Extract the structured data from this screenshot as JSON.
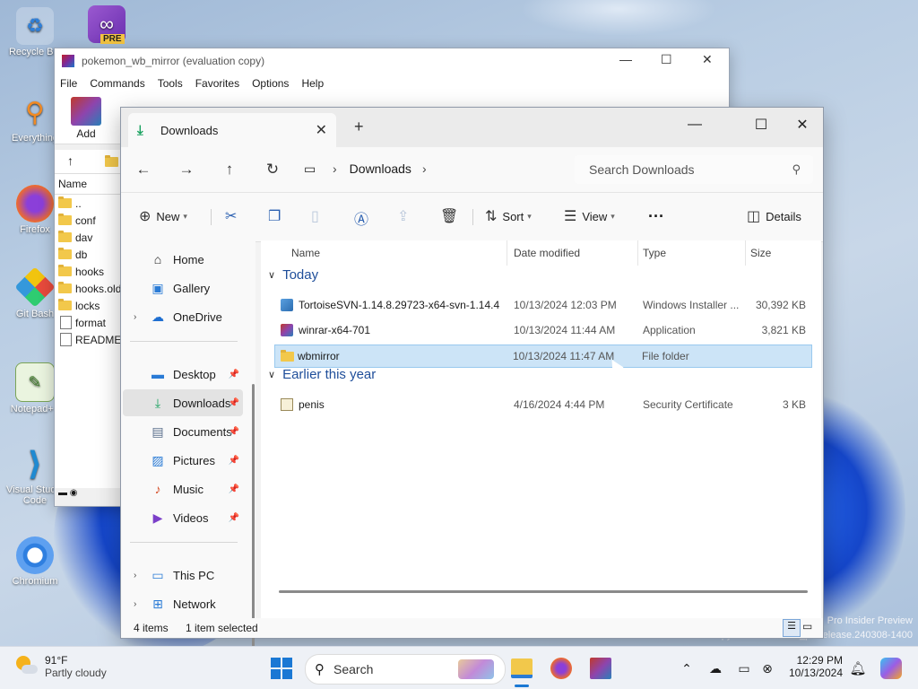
{
  "desktop": {
    "icons": [
      {
        "label": "Recycle Bin",
        "icon": "recycle-bin-icon"
      },
      {
        "label": "Everything",
        "icon": "search-magnifier-icon"
      },
      {
        "label": "Firefox",
        "icon": "firefox-icon"
      },
      {
        "label": "Git Bash",
        "icon": "git-icon"
      },
      {
        "label": "Notepad++",
        "icon": "notepad-plus-icon"
      },
      {
        "label": "Visual Studio Code",
        "icon": "vscode-icon"
      },
      {
        "label": "Chromium",
        "icon": "chromium-icon"
      }
    ],
    "pre_badge": "PRE",
    "watermark_line1": "Pro Insider Preview",
    "watermark_line2": "Evaluation copy. Build 26000.rs_prerelease.240308-1400"
  },
  "winrar": {
    "title": "pokemon_wb_mirror (evaluation copy)",
    "menu": [
      "File",
      "Commands",
      "Tools",
      "Favorites",
      "Options",
      "Help"
    ],
    "add_label": "Add",
    "list_header": "Name",
    "items": [
      {
        "name": "..",
        "type": "folder"
      },
      {
        "name": "conf",
        "type": "folder"
      },
      {
        "name": "dav",
        "type": "folder"
      },
      {
        "name": "db",
        "type": "folder"
      },
      {
        "name": "hooks",
        "type": "folder"
      },
      {
        "name": "hooks.old",
        "type": "folder"
      },
      {
        "name": "locks",
        "type": "folder"
      },
      {
        "name": "format",
        "type": "file"
      },
      {
        "name": "README.txt",
        "type": "file"
      }
    ]
  },
  "explorer": {
    "tab_title": "Downloads",
    "address_crumb": "Downloads",
    "search_placeholder": "Search Downloads",
    "commands": {
      "new": "New",
      "sort": "Sort",
      "view": "View",
      "details": "Details"
    },
    "nav": {
      "home": "Home",
      "gallery": "Gallery",
      "onedrive": "OneDrive",
      "desktop": "Desktop",
      "downloads": "Downloads",
      "documents": "Documents",
      "pictures": "Pictures",
      "music": "Music",
      "videos": "Videos",
      "thispc": "This PC",
      "network": "Network"
    },
    "columns": {
      "name": "Name",
      "date": "Date modified",
      "type": "Type",
      "size": "Size"
    },
    "groups": [
      {
        "label": "Today",
        "files": [
          {
            "name": "TortoiseSVN-1.14.8.29723-x64-svn-1.14.4",
            "date": "10/13/2024 12:03 PM",
            "type": "Windows Installer ...",
            "size": "30,392 KB",
            "icon": "installer-icon"
          },
          {
            "name": "winrar-x64-701",
            "date": "10/13/2024 11:44 AM",
            "type": "Application",
            "size": "3,821 KB",
            "icon": "winrar-icon"
          },
          {
            "name": "wbmirror",
            "date": "10/13/2024 11:47 AM",
            "type": "File folder",
            "size": "",
            "icon": "folder-icon",
            "selected": true
          }
        ]
      },
      {
        "label": "Earlier this year",
        "files": [
          {
            "name": "penis",
            "date": "4/16/2024 4:44 PM",
            "type": "Security Certificate",
            "size": "3 KB",
            "icon": "certificate-icon"
          }
        ]
      }
    ],
    "status_items": "4 items",
    "status_selected": "1 item selected"
  },
  "taskbar": {
    "temperature": "91°F",
    "condition": "Partly cloudy",
    "search_label": "Search",
    "time": "12:29 PM",
    "date": "10/13/2024"
  }
}
